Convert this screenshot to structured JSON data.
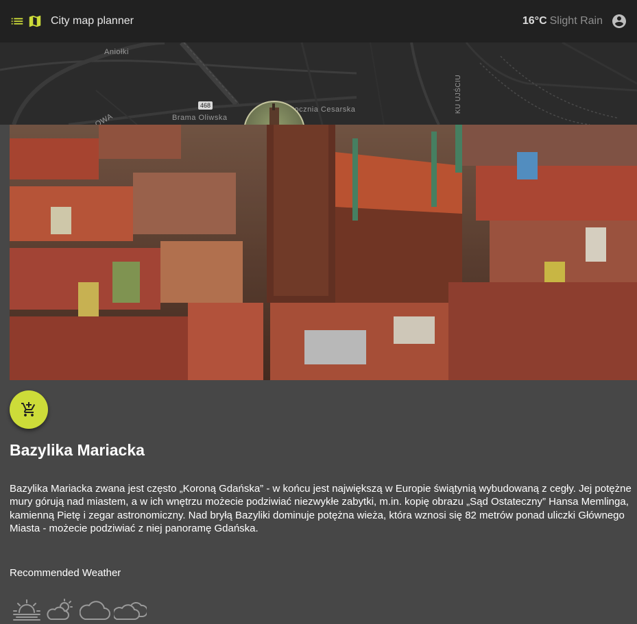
{
  "header": {
    "menu_icon": "list-icon",
    "map_icon": "map-icon",
    "title": "City map planner",
    "temperature": "16°C",
    "condition": "Slight Rain",
    "account_icon": "account-circle-icon"
  },
  "map": {
    "labels": {
      "aniolki": "Aniołki",
      "brama": "Brama Oliwska",
      "stocznia": "tocznia Cesarska",
      "owa": "OWA",
      "kujuscie": "KU UJŚCIU"
    },
    "road_badge": "468"
  },
  "place": {
    "title": "Bazylika Mariacka",
    "description": "Bazylika Mariacka zwana jest często „Koroną Gdańska” - w końcu jest największą w Europie świątynią wybudowaną z cegły. Jej potężne mury górują nad miastem, a w ich wnętrzu możecie podziwiać niezwykłe zabytki, m.in. kopię obrazu „Sąd Ostateczny” Hansa Memlinga, kamienną Pietę i zegar astronomiczny. Nad bryłą Bazyliki dominuje potężna wieża, która wznosi się 82 metrów ponad uliczki Głównego Miasta - możecie podziwiać z niej panoramę Gdańska.",
    "add_icon": "add-shopping-cart-icon"
  },
  "weather": {
    "label": "Recommended Weather",
    "icons": [
      "sunrise-icon",
      "partly-cloudy-icon",
      "cloud-icon",
      "clouds-icon"
    ]
  },
  "colors": {
    "background": "#474747",
    "appbar": "#212121",
    "accent": "#cddc39"
  }
}
